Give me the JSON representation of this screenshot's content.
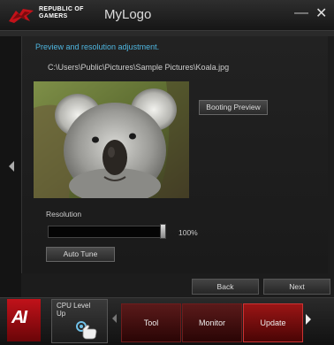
{
  "titlebar": {
    "brand_line1": "REPUBLIC OF",
    "brand_line2": "GAMERS",
    "app_title": "MyLogo",
    "minimize_glyph": "—",
    "close_glyph": "✕"
  },
  "main": {
    "heading": "Preview and resolution adjustment.",
    "file_path": "C:\\Users\\Public\\Pictures\\Sample Pictures\\Koala.jpg",
    "booting_preview_label": "Booting Preview",
    "resolution_label": "Resolution",
    "resolution_value": "100%",
    "resolution_level": 1.0,
    "auto_tune_label": "Auto Tune"
  },
  "wizard": {
    "back_label": "Back",
    "next_label": "Next"
  },
  "bottombar": {
    "logo_text": "AI",
    "cpu_label": "CPU Level Up",
    "tabs": [
      {
        "label": "Tool"
      },
      {
        "label": "Monitor"
      },
      {
        "label": "Update"
      }
    ]
  },
  "colors": {
    "accent_blue": "#4fb6e0",
    "rog_red": "#c1121a",
    "tab_red": "#5a1a1a"
  }
}
